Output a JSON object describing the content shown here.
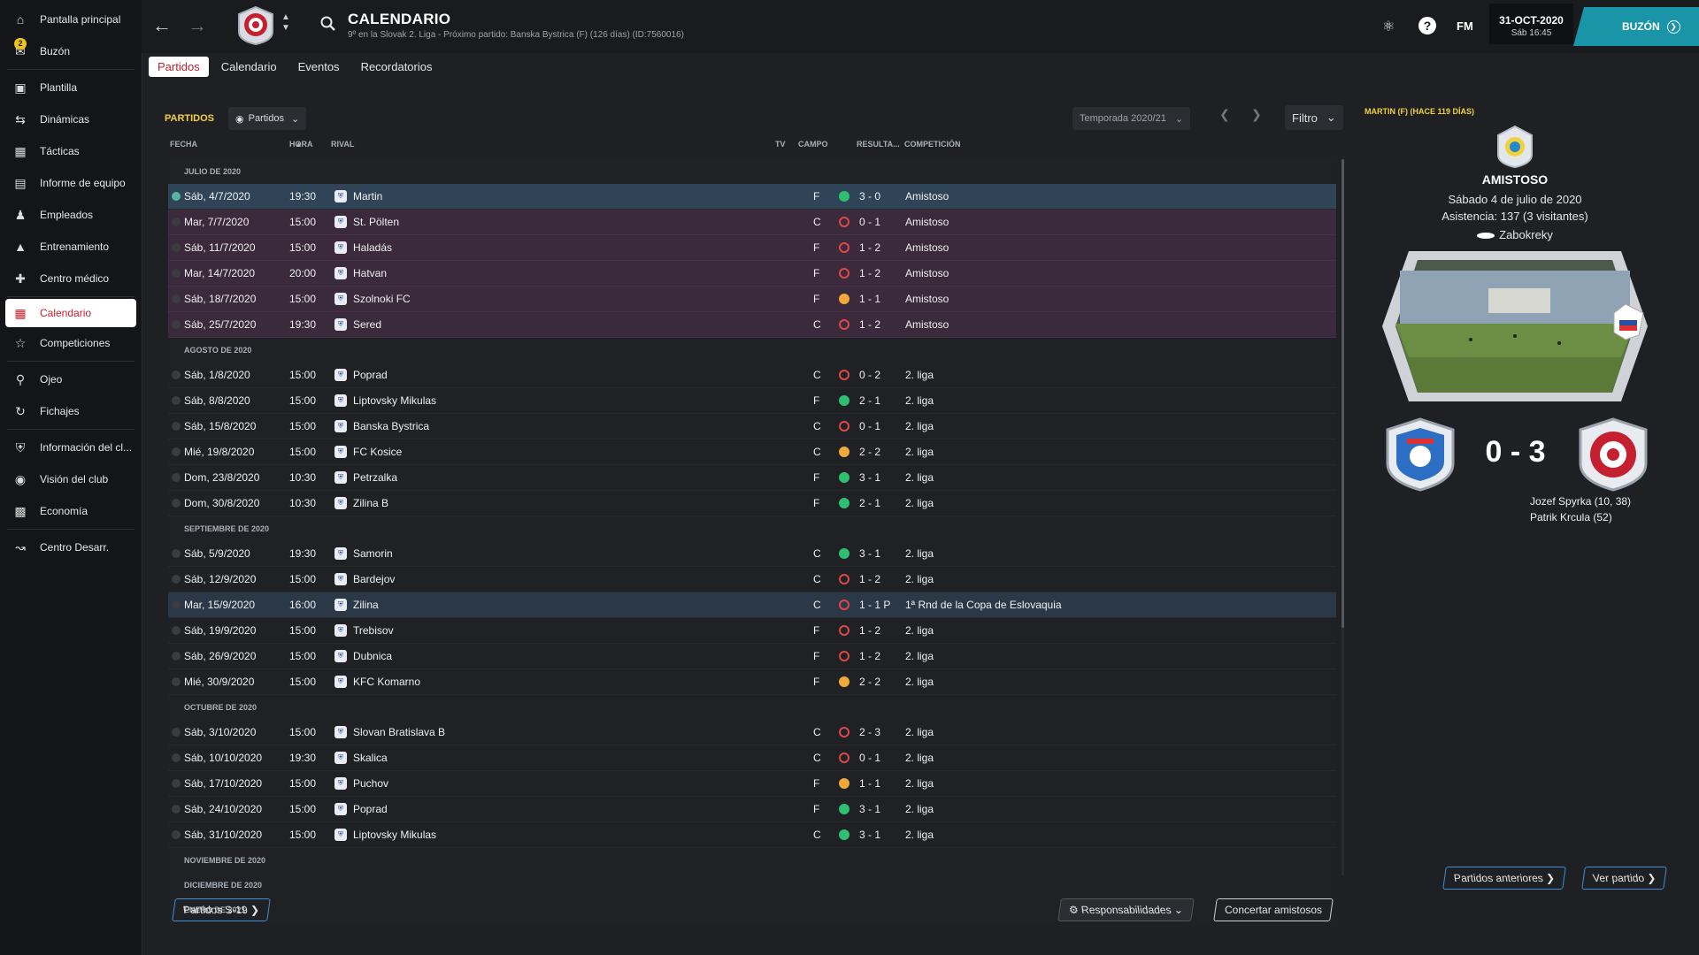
{
  "sidebar": {
    "items": [
      {
        "label": "Pantalla principal",
        "icon": "home-icon"
      },
      {
        "label": "Buzón",
        "icon": "inbox-icon",
        "badge": "2"
      },
      {
        "label": "Plantilla",
        "icon": "squad-icon"
      },
      {
        "label": "Dinámicas",
        "icon": "dynamics-icon"
      },
      {
        "label": "Tácticas",
        "icon": "tactics-icon"
      },
      {
        "label": "Informe de equipo",
        "icon": "report-icon"
      },
      {
        "label": "Empleados",
        "icon": "staff-icon"
      },
      {
        "label": "Entrenamiento",
        "icon": "training-icon"
      },
      {
        "label": "Centro médico",
        "icon": "medical-icon"
      },
      {
        "label": "Calendario",
        "icon": "calendar-icon",
        "active": true
      },
      {
        "label": "Competiciones",
        "icon": "trophy-icon"
      },
      {
        "label": "Ojeo",
        "icon": "scouting-icon"
      },
      {
        "label": "Fichajes",
        "icon": "transfers-icon"
      },
      {
        "label": "Información del cl...",
        "icon": "club-info-icon"
      },
      {
        "label": "Visión del club",
        "icon": "vision-icon"
      },
      {
        "label": "Economía",
        "icon": "finances-icon"
      },
      {
        "label": "Centro Desarr.",
        "icon": "development-icon"
      }
    ]
  },
  "header": {
    "title": "CALENDARIO",
    "subtitle": "9º en la Slovak 2. Liga - Próximo partido: Banska Bystrica (F)  (126 días) (ID:7560016)",
    "fm_label": "FM",
    "date": "31-OCT-2020",
    "time": "Sáb 16:45",
    "inbox_button": "BUZÓN"
  },
  "tabs": [
    "Partidos",
    "Calendario",
    "Eventos",
    "Recordatorios"
  ],
  "filters": {
    "section_label": "PARTIDOS",
    "view_dropdown": "Partidos",
    "season_dropdown": "Temporada 2020/21",
    "filter_label": "Filtro"
  },
  "columns": {
    "date": "FECHA",
    "time": "HORA",
    "opponent": "RIVAL",
    "tv": "TV",
    "venue": "CAMPO",
    "result": "RESULTA...",
    "competition": "COMPETICIÓN"
  },
  "months": [
    {
      "name": "JULIO DE 2020",
      "matches": [
        {
          "date": "Sáb, 4/7/2020",
          "time": "19:30",
          "opponent": "Martin",
          "venue": "F",
          "outcome": "W",
          "result": "3 - 0",
          "competition": "Amistoso",
          "style": "selected"
        },
        {
          "date": "Mar, 7/7/2020",
          "time": "15:00",
          "opponent": "St. Pölten",
          "venue": "C",
          "outcome": "L",
          "result": "0 - 1",
          "competition": "Amistoso",
          "style": "friendly"
        },
        {
          "date": "Sáb, 11/7/2020",
          "time": "15:00",
          "opponent": "Haladás",
          "venue": "F",
          "outcome": "L",
          "result": "1 - 2",
          "competition": "Amistoso",
          "style": "friendly"
        },
        {
          "date": "Mar, 14/7/2020",
          "time": "20:00",
          "opponent": "Hatvan",
          "venue": "F",
          "outcome": "L",
          "result": "1 - 2",
          "competition": "Amistoso",
          "style": "friendly"
        },
        {
          "date": "Sáb, 18/7/2020",
          "time": "15:00",
          "opponent": "Szolnoki FC",
          "venue": "F",
          "outcome": "D",
          "result": "1 - 1",
          "competition": "Amistoso",
          "style": "friendly"
        },
        {
          "date": "Sáb, 25/7/2020",
          "time": "19:30",
          "opponent": "Sered",
          "venue": "C",
          "outcome": "L",
          "result": "1 - 2",
          "competition": "Amistoso",
          "style": "friendly"
        }
      ]
    },
    {
      "name": "AGOSTO DE 2020",
      "matches": [
        {
          "date": "Sáb, 1/8/2020",
          "time": "15:00",
          "opponent": "Poprad",
          "venue": "C",
          "outcome": "L",
          "result": "0 - 2",
          "competition": "2. liga",
          "style": ""
        },
        {
          "date": "Sáb, 8/8/2020",
          "time": "15:00",
          "opponent": "Liptovsky Mikulas",
          "venue": "F",
          "outcome": "W",
          "result": "2 - 1",
          "competition": "2. liga",
          "style": ""
        },
        {
          "date": "Sáb, 15/8/2020",
          "time": "15:00",
          "opponent": "Banska Bystrica",
          "venue": "C",
          "outcome": "L",
          "result": "0 - 1",
          "competition": "2. liga",
          "style": ""
        },
        {
          "date": "Mié, 19/8/2020",
          "time": "15:00",
          "opponent": "FC Kosice",
          "venue": "C",
          "outcome": "D",
          "result": "2 - 2",
          "competition": "2. liga",
          "style": ""
        },
        {
          "date": "Dom, 23/8/2020",
          "time": "10:30",
          "opponent": "Petrzalka",
          "venue": "F",
          "outcome": "W",
          "result": "3 - 1",
          "competition": "2. liga",
          "style": ""
        },
        {
          "date": "Dom, 30/8/2020",
          "time": "10:30",
          "opponent": "Zilina B",
          "venue": "F",
          "outcome": "W",
          "result": "2 - 1",
          "competition": "2. liga",
          "style": ""
        }
      ]
    },
    {
      "name": "SEPTIEMBRE DE 2020",
      "matches": [
        {
          "date": "Sáb, 5/9/2020",
          "time": "19:30",
          "opponent": "Samorin",
          "venue": "C",
          "outcome": "W",
          "result": "3 - 1",
          "competition": "2. liga",
          "style": ""
        },
        {
          "date": "Sáb, 12/9/2020",
          "time": "15:00",
          "opponent": "Bardejov",
          "venue": "C",
          "outcome": "L",
          "result": "1 - 2",
          "competition": "2. liga",
          "style": ""
        },
        {
          "date": "Mar, 15/9/2020",
          "time": "16:00",
          "opponent": "Zilina",
          "venue": "C",
          "outcome": "L",
          "result": "1 - 1 P",
          "competition": "1ª Rnd de la Copa de Eslovaquia",
          "style": "highlight"
        },
        {
          "date": "Sáb, 19/9/2020",
          "time": "15:00",
          "opponent": "Trebisov",
          "venue": "F",
          "outcome": "L",
          "result": "1 - 2",
          "competition": "2. liga",
          "style": ""
        },
        {
          "date": "Sáb, 26/9/2020",
          "time": "15:00",
          "opponent": "Dubnica",
          "venue": "F",
          "outcome": "L",
          "result": "1 - 2",
          "competition": "2. liga",
          "style": ""
        },
        {
          "date": "Mié, 30/9/2020",
          "time": "15:00",
          "opponent": "KFC Komarno",
          "venue": "F",
          "outcome": "D",
          "result": "2 - 2",
          "competition": "2. liga",
          "style": ""
        }
      ]
    },
    {
      "name": "OCTUBRE DE 2020",
      "matches": [
        {
          "date": "Sáb, 3/10/2020",
          "time": "15:00",
          "opponent": "Slovan Bratislava B",
          "venue": "C",
          "outcome": "L",
          "result": "2 - 3",
          "competition": "2. liga",
          "style": ""
        },
        {
          "date": "Sáb, 10/10/2020",
          "time": "19:30",
          "opponent": "Skalica",
          "venue": "C",
          "outcome": "L",
          "result": "0 - 1",
          "competition": "2. liga",
          "style": ""
        },
        {
          "date": "Sáb, 17/10/2020",
          "time": "15:00",
          "opponent": "Puchov",
          "venue": "F",
          "outcome": "D",
          "result": "1 - 1",
          "competition": "2. liga",
          "style": ""
        },
        {
          "date": "Sáb, 24/10/2020",
          "time": "15:00",
          "opponent": "Poprad",
          "venue": "F",
          "outcome": "W",
          "result": "3 - 1",
          "competition": "2. liga",
          "style": ""
        },
        {
          "date": "Sáb, 31/10/2020",
          "time": "15:00",
          "opponent": "Liptovsky Mikulas",
          "venue": "C",
          "outcome": "W",
          "result": "3 - 1",
          "competition": "2. liga",
          "style": ""
        }
      ]
    },
    {
      "name": "NOVIEMBRE DE 2020",
      "matches": []
    },
    {
      "name": "DICIEMBRE DE 2020",
      "matches": []
    },
    {
      "name": "ENERO DE 2021",
      "matches": []
    }
  ],
  "bottom": {
    "u19_button": "Partidos S-19",
    "responsibilities": "Responsabilidades",
    "arrange_friendlies": "Concertar amistosos"
  },
  "match_panel": {
    "header": "MARTIN (F) (HACE 119 DÍAS)",
    "competition": "AMISTOSO",
    "date": "Sábado 4 de julio de 2020",
    "attendance": "Asistencia: 137 (3 visitantes)",
    "stadium": "Zabokreky",
    "score": "0 - 3",
    "scorers": [
      "Jozef Spyrka (10, 38)",
      "Patrik Krcula (52)"
    ],
    "prev_matches_button": "Partidos anteriores",
    "view_match_button": "Ver partido"
  },
  "colors": {
    "accent": "#c4202f",
    "highlight": "#f4d03f",
    "win": "#2fbf71",
    "loss": "#e04848",
    "draw": "#f1a93a",
    "teal": "#1a95a8"
  }
}
